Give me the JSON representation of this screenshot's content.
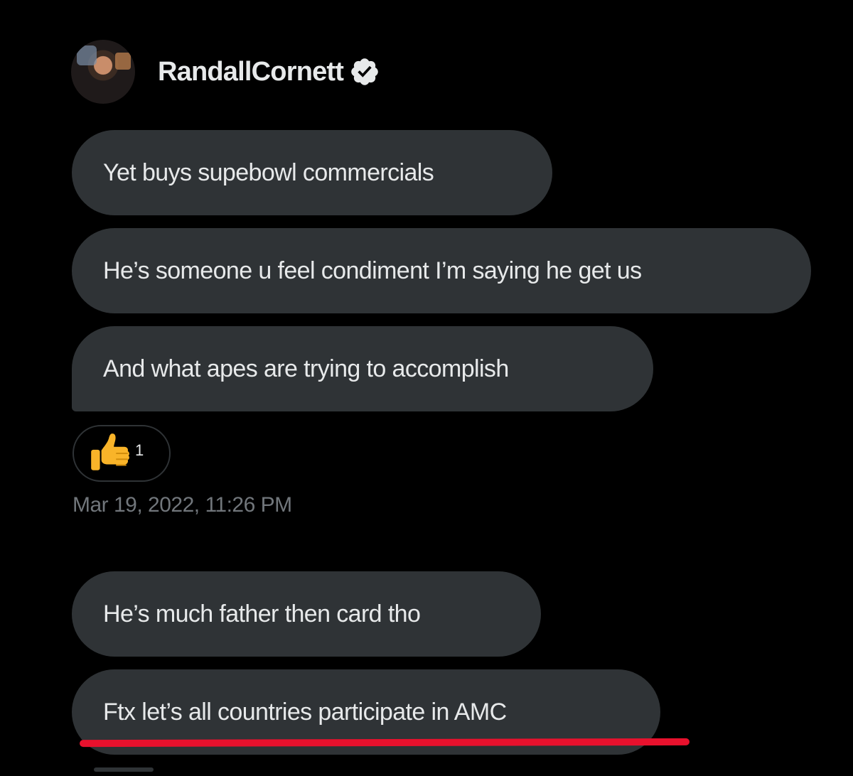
{
  "header": {
    "username": "RandallCornett",
    "verified_icon": "verified-badge-icon",
    "avatar": "user-avatar"
  },
  "messages_group_1": [
    {
      "text": "Yet buys supebowl commercials"
    },
    {
      "text": "He’s someone u feel condiment I’m saying he get us"
    },
    {
      "text": "And what apes are trying to accomplish"
    }
  ],
  "reaction": {
    "emoji": "thumbs-up-icon",
    "count": "1"
  },
  "timestamp": "Mar 19, 2022, 11:26 PM",
  "messages_group_2": [
    {
      "text": "He’s much father then card tho"
    },
    {
      "text": "Ftx let’s all countries participate in AMC"
    }
  ],
  "colors": {
    "background": "#000000",
    "bubble": "#2f3336",
    "text": "#e7e9ea",
    "muted_text": "#71767b",
    "highlight_underline": "#e8112d"
  }
}
